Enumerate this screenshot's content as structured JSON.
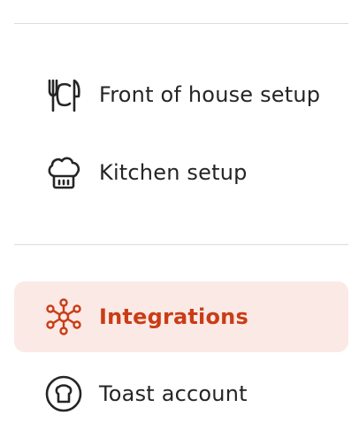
{
  "theme": {
    "text_color": "#252525",
    "accent_color": "#c93d16",
    "active_background": "#fbe9e5",
    "divider_color": "#dcdcdc"
  },
  "nav": {
    "items": [
      {
        "label": "Front of house setup",
        "icon": "utensils-icon",
        "active": false
      },
      {
        "label": "Kitchen setup",
        "icon": "chef-hat-icon",
        "active": false
      },
      {
        "label": "Integrations",
        "icon": "network-hub-icon",
        "active": true
      },
      {
        "label": "Toast account",
        "icon": "toast-bread-icon",
        "active": false
      }
    ]
  }
}
